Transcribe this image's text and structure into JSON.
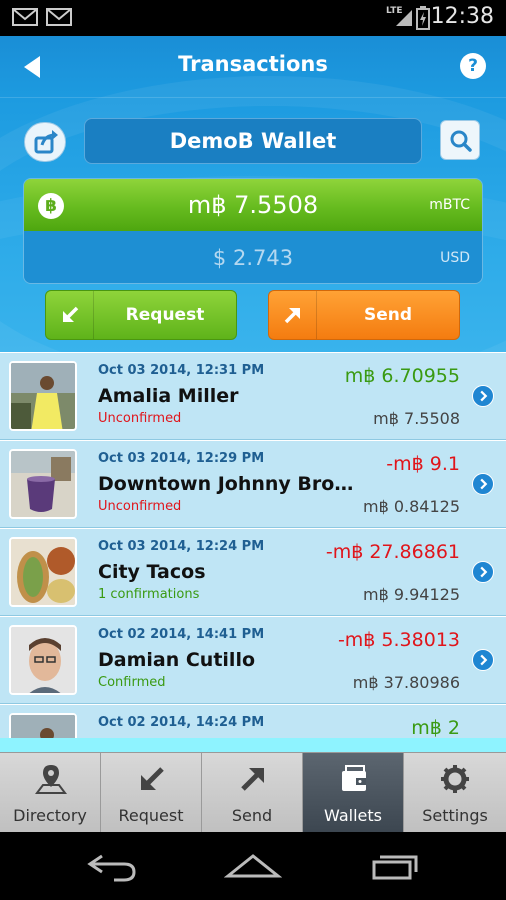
{
  "statusbar": {
    "time": "12:38",
    "network": "LTE"
  },
  "header": {
    "title": "Transactions",
    "help_label": "?",
    "wallet_name": "DemoB Wallet"
  },
  "balance": {
    "btc_symbol": "฿",
    "btc_amount": "m฿ 7.5508",
    "btc_unit": "mBTC",
    "usd_amount": "$ 2.743",
    "usd_unit": "USD"
  },
  "actions": {
    "request_label": "Request",
    "send_label": "Send"
  },
  "transactions": [
    {
      "date": "Oct 03 2014, 12:31 PM",
      "name": "Amalia Miller",
      "status": "Unconfirmed",
      "status_color": "#e0151b",
      "amount": "m฿  6.70955",
      "amount_color": "#3a9a12",
      "balance": "m฿  7.5508"
    },
    {
      "date": "Oct 03 2014, 12:29 PM",
      "name": "Downtown Johnny Brow…",
      "status": "Unconfirmed",
      "status_color": "#e0151b",
      "amount": "-m฿  9.1",
      "amount_color": "#e0151b",
      "balance": "m฿  0.84125"
    },
    {
      "date": "Oct 03 2014, 12:24 PM",
      "name": "City Tacos",
      "status": "1 confirmations",
      "status_color": "#3a9a12",
      "amount": "-m฿  27.86861",
      "amount_color": "#e0151b",
      "balance": "m฿  9.94125"
    },
    {
      "date": "Oct 02 2014, 14:41 PM",
      "name": "Damian Cutillo",
      "status": "Confirmed",
      "status_color": "#3a9a12",
      "amount": "-m฿  5.38013",
      "amount_color": "#e0151b",
      "balance": "m฿  37.80986"
    },
    {
      "date": "Oct 02 2014, 14:24 PM",
      "name": "",
      "status": "",
      "status_color": "#3a9a12",
      "amount": "m฿  2",
      "amount_color": "#3a9a12",
      "balance": ""
    }
  ],
  "bottom_nav": [
    {
      "label": "Directory",
      "icon": "map-pin-icon",
      "active": false
    },
    {
      "label": "Request",
      "icon": "arrow-down-left-icon",
      "active": false
    },
    {
      "label": "Send",
      "icon": "arrow-up-right-icon",
      "active": false
    },
    {
      "label": "Wallets",
      "icon": "wallet-icon",
      "active": true
    },
    {
      "label": "Settings",
      "icon": "gear-icon",
      "active": false
    }
  ],
  "colors": {
    "accent": "#1e8fd3",
    "green": "#66bb1f",
    "orange": "#f47c10",
    "red": "#e0151b"
  }
}
